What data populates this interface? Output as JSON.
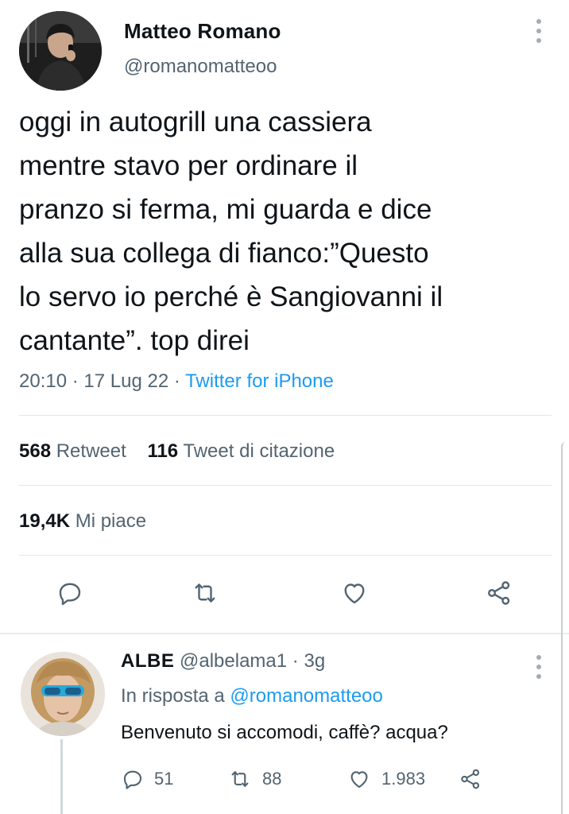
{
  "tweet": {
    "author_name": "Matteo Romano",
    "author_handle": "@romanomatteoo",
    "text": "oggi in autogrill una cassiera\nmentre stavo per ordinare il\npranzo si ferma, mi guarda e dice\nalla sua collega di fianco:”Questo\nlo servo io perché è Sangiovanni il\ncantante”. top direi",
    "time": "20:10",
    "date": "17 Lug 22",
    "separator": "·",
    "source": "Twitter for iPhone",
    "retweets_count": "568",
    "retweets_label": "Retweet",
    "quotes_count": "116",
    "quotes_label": "Tweet di citazione",
    "likes_count": "19,4K",
    "likes_label": "Mi piace"
  },
  "actions": {
    "icons": [
      "reply-icon",
      "retweet-icon",
      "like-icon",
      "share-icon"
    ]
  },
  "reply": {
    "author_name": "ALBE",
    "author_handle": "@albelama1",
    "separator": "·",
    "time_ago": "3g",
    "in_reply_prefix": "In risposta a",
    "in_reply_mention": "@romanomatteoo",
    "text": "Benvenuto si accomodi, caffè? acqua?",
    "replies": "51",
    "retweets": "88",
    "likes": "1.983"
  },
  "colors": {
    "accent": "#1d9bf0",
    "text_primary": "#0f1419",
    "text_secondary": "#536471",
    "divider": "#e1e6ea"
  }
}
